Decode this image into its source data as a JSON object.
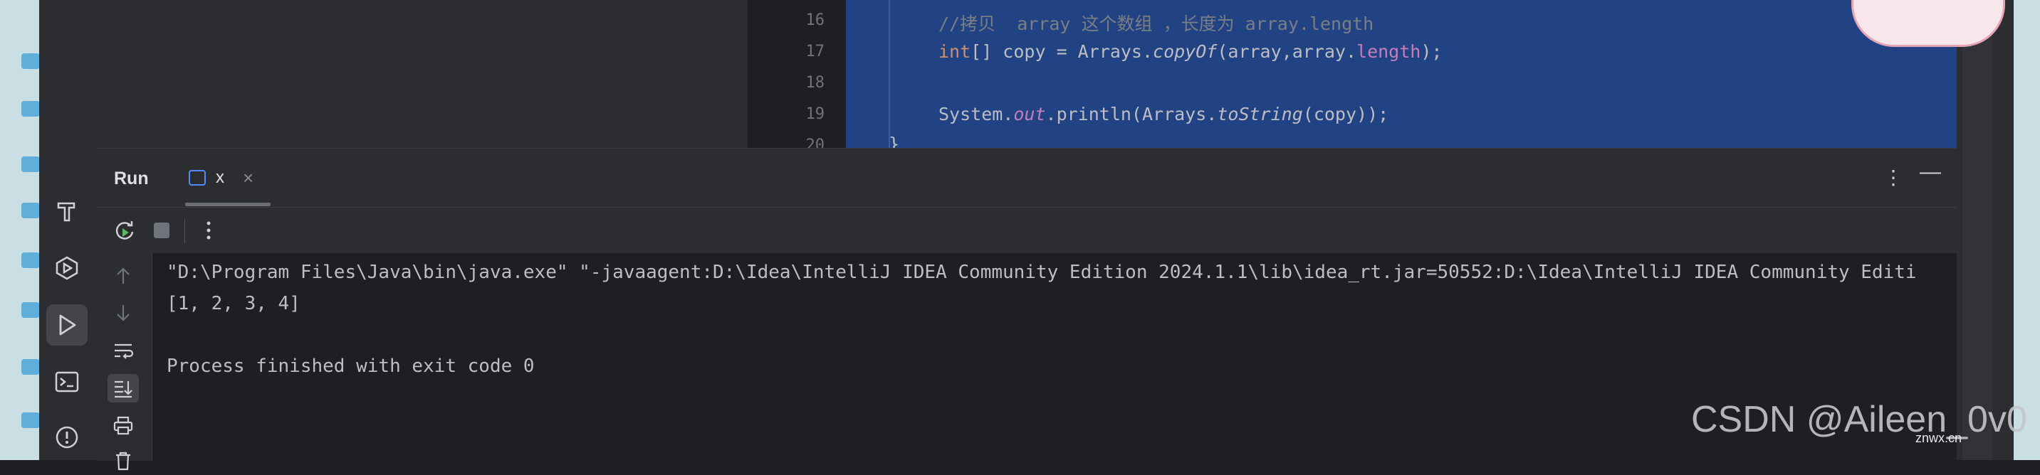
{
  "editor": {
    "line_numbers": [
      "16",
      "17",
      "18",
      "19",
      "20"
    ],
    "line16_comment": "//拷贝  array 这个数组 ，长度为 array.length",
    "line17": {
      "type": "int",
      "rest_a": "[] copy = Arrays.",
      "method": "copyOf",
      "rest_b": "(array,array.",
      "field": "length",
      "rest_c": ");"
    },
    "line19": {
      "a": "System.",
      "out": "out",
      "b": ".println(Arrays.",
      "method": "toString",
      "c": "(copy));"
    },
    "line20": "}"
  },
  "run_window": {
    "title": "Run",
    "tab_label": "x",
    "tab_close": "×",
    "menu_glyph": "⋮",
    "minimize_glyph": "—"
  },
  "console": {
    "lines": [
      "\"D:\\Program Files\\Java\\bin\\java.exe\" \"-javaagent:D:\\Idea\\IntelliJ IDEA Community Edition 2024.1.1\\lib\\idea_rt.jar=50552:D:\\Idea\\IntelliJ IDEA Community Editi",
      "[1, 2, 3, 4]",
      "",
      "Process finished with exit code 0"
    ]
  },
  "watermark": {
    "text": "CSDN @Aileen_0v0",
    "small": "znwx.cn"
  },
  "colors": {
    "selection": "#214283",
    "accent": "#548af7",
    "background": "#1e1f22"
  }
}
